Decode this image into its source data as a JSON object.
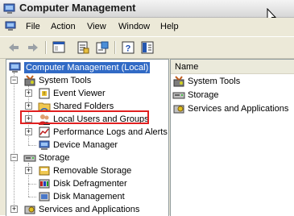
{
  "window": {
    "title": "Computer Management"
  },
  "menu": {
    "items": [
      "File",
      "Action",
      "View",
      "Window",
      "Help"
    ]
  },
  "toolbar": {
    "buttons": [
      "back-icon",
      "forward-icon",
      "show-hide-tree-icon",
      "properties-icon",
      "export-list-icon",
      "help-icon",
      "console-tree-icon"
    ]
  },
  "tree": {
    "root": "Computer Management (Local)",
    "system_tools": "System Tools",
    "event_viewer": "Event Viewer",
    "shared_folders": "Shared Folders",
    "local_users_groups": "Local Users and Groups",
    "performance_logs": "Performance Logs and Alerts",
    "device_manager": "Device Manager",
    "storage": "Storage",
    "removable_storage": "Removable Storage",
    "disk_defragmenter": "Disk Defragmenter",
    "disk_management": "Disk Management",
    "services_apps": "Services and Applications"
  },
  "list": {
    "column": "Name",
    "items": [
      "System Tools",
      "Storage",
      "Services and Applications"
    ]
  },
  "colors": {
    "highlight": "#e02020",
    "selection": "#316ac5"
  }
}
